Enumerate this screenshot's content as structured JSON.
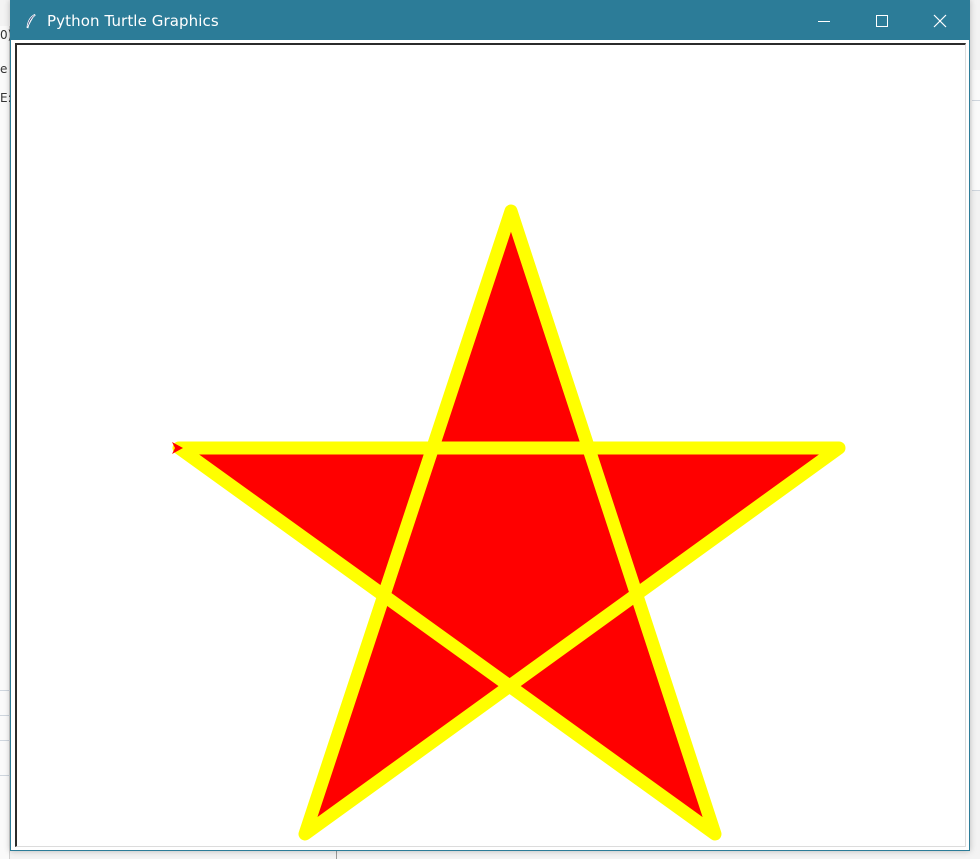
{
  "window": {
    "title": "Python Turtle Graphics",
    "icon": "feather-icon",
    "controls": [
      "minimize-icon",
      "maximize-icon",
      "close-icon"
    ]
  },
  "colors": {
    "titlebar": "#2c7c98",
    "star_fill": "#ff0000",
    "star_outline": "#ffff00",
    "turtle": "#ff0000",
    "canvas_background": "#ffffff"
  },
  "background_fragments": [
    "0)",
    "e",
    "E:"
  ]
}
